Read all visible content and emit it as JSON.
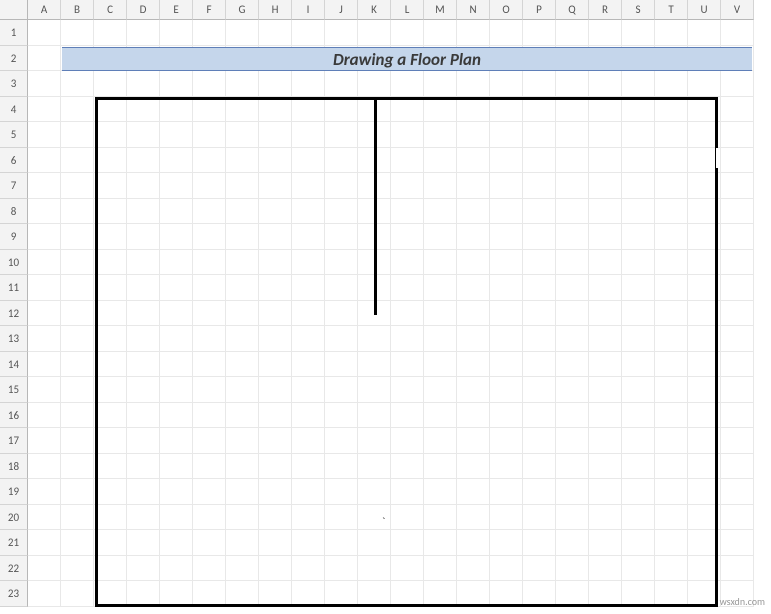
{
  "columns": [
    "A",
    "B",
    "C",
    "D",
    "E",
    "F",
    "G",
    "H",
    "I",
    "J",
    "K",
    "L",
    "M",
    "N",
    "O",
    "P",
    "Q",
    "R",
    "S",
    "T",
    "U",
    "V"
  ],
  "rows": [
    "1",
    "2",
    "3",
    "4",
    "5",
    "6",
    "7",
    "8",
    "9",
    "10",
    "11",
    "12",
    "13",
    "14",
    "15",
    "16",
    "17",
    "18",
    "19",
    "20",
    "21",
    "22",
    "23"
  ],
  "title": "Drawing a Floor Plan",
  "stray": "`",
  "watermark": "wsxdn.com"
}
